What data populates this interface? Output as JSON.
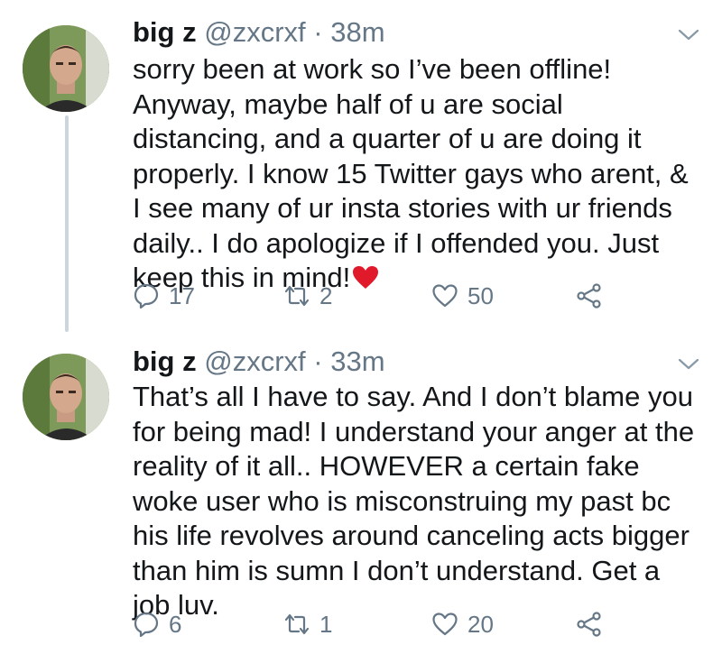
{
  "tweets": [
    {
      "name": "big z",
      "handle": "@zxcrxf",
      "separator": "·",
      "time": "38m",
      "text": "sorry been at work so I’ve been offline! Anyway, maybe half of u are social distancing, and a quarter of u are doing it properly. I know 15 Twitter gays who arent, & I see many of ur insta stories with ur friends daily.. I do apologize if I offended you. Just keep this in mind!",
      "emoji": "red-heart",
      "replies": "17",
      "retweets": "2",
      "likes": "50"
    },
    {
      "name": "big z",
      "handle": "@zxcrxf",
      "separator": "·",
      "time": "33m",
      "text": "That’s all I have to say. And I don’t blame you for being mad! I understand your anger at the reality of it all.. HOWEVER a certain fake woke user who is misconstruing my past bc his life revolves around canceling acts bigger than him is sumn I don’t understand. Get a job luv.",
      "replies": "6",
      "retweets": "1",
      "likes": "20"
    }
  ],
  "icons": {
    "reply": "reply-icon",
    "retweet": "retweet-icon",
    "like": "like-icon",
    "share": "share-icon",
    "more": "chevron-down-icon"
  },
  "colors": {
    "text": "#14171a",
    "secondary": "#657786",
    "thread_line": "#ccd6dd",
    "heart_emoji": "#e0192b"
  }
}
